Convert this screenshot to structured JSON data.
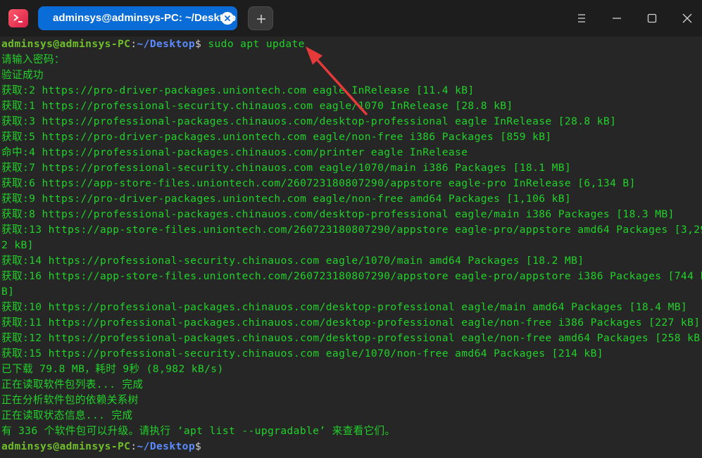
{
  "window": {
    "tab_title": "adminsys@adminsys-PC: ~/Desktop"
  },
  "colors": {
    "terminal_bg": "#262626",
    "output_text": "#22d22a",
    "prompt_user": "#6fbf2c",
    "prompt_path": "#5b8cff",
    "tab_active": "#0a6cd6",
    "annotation_arrow": "#e63a3a"
  },
  "icons": {
    "app": "terminal-app-icon",
    "tab_close": "close-circle-icon",
    "new_tab": "plus-icon",
    "menu": "hamburger-menu-icon",
    "minimize": "minimize-icon",
    "maximize": "maximize-icon",
    "close": "close-icon"
  },
  "terminal": {
    "prompt": {
      "user_host": "adminsys@adminsys-PC",
      "separator": ":",
      "path": "~/Desktop",
      "symbol": "$"
    },
    "command": " sudo apt update",
    "output_lines": [
      "请输入密码：",
      "验证成功",
      "获取:2 https://pro-driver-packages.uniontech.com eagle InRelease [11.4 kB]",
      "获取:1 https://professional-security.chinauos.com eagle/1070 InRelease [28.8 kB]",
      "获取:3 https://professional-packages.chinauos.com/desktop-professional eagle InRelease [28.8 kB]",
      "获取:5 https://pro-driver-packages.uniontech.com eagle/non-free i386 Packages [859 kB]",
      "命中:4 https://professional-packages.chinauos.com/printer eagle InRelease",
      "获取:7 https://professional-security.chinauos.com eagle/1070/main i386 Packages [18.1 MB]",
      "获取:6 https://app-store-files.uniontech.com/260723180807290/appstore eagle-pro InRelease [6,134 B]",
      "获取:9 https://pro-driver-packages.uniontech.com eagle/non-free amd64 Packages [1,106 kB]",
      "获取:8 https://professional-packages.chinauos.com/desktop-professional eagle/main i386 Packages [18.3 MB]",
      "获取:13 https://app-store-files.uniontech.com/260723180807290/appstore eagle-pro/appstore amd64 Packages [3,29",
      "2 kB]",
      "获取:14 https://professional-security.chinauos.com eagle/1070/main amd64 Packages [18.2 MB]",
      "获取:16 https://app-store-files.uniontech.com/260723180807290/appstore eagle-pro/appstore i386 Packages [744 k",
      "B]",
      "获取:10 https://professional-packages.chinauos.com/desktop-professional eagle/main amd64 Packages [18.4 MB]",
      "获取:11 https://professional-packages.chinauos.com/desktop-professional eagle/non-free i386 Packages [227 kB]",
      "获取:12 https://professional-packages.chinauos.com/desktop-professional eagle/non-free amd64 Packages [258 kB]",
      "获取:15 https://professional-security.chinauos.com eagle/1070/non-free amd64 Packages [214 kB]",
      "已下载 79.8 MB，耗时 9秒 (8,982 kB/s)",
      "正在读取软件包列表... 完成",
      "正在分析软件包的依赖关系树",
      "正在读取状态信息... 完成",
      "有 336 个软件包可以升级。请执行 ‘apt list --upgradable’ 来查看它们。"
    ]
  }
}
